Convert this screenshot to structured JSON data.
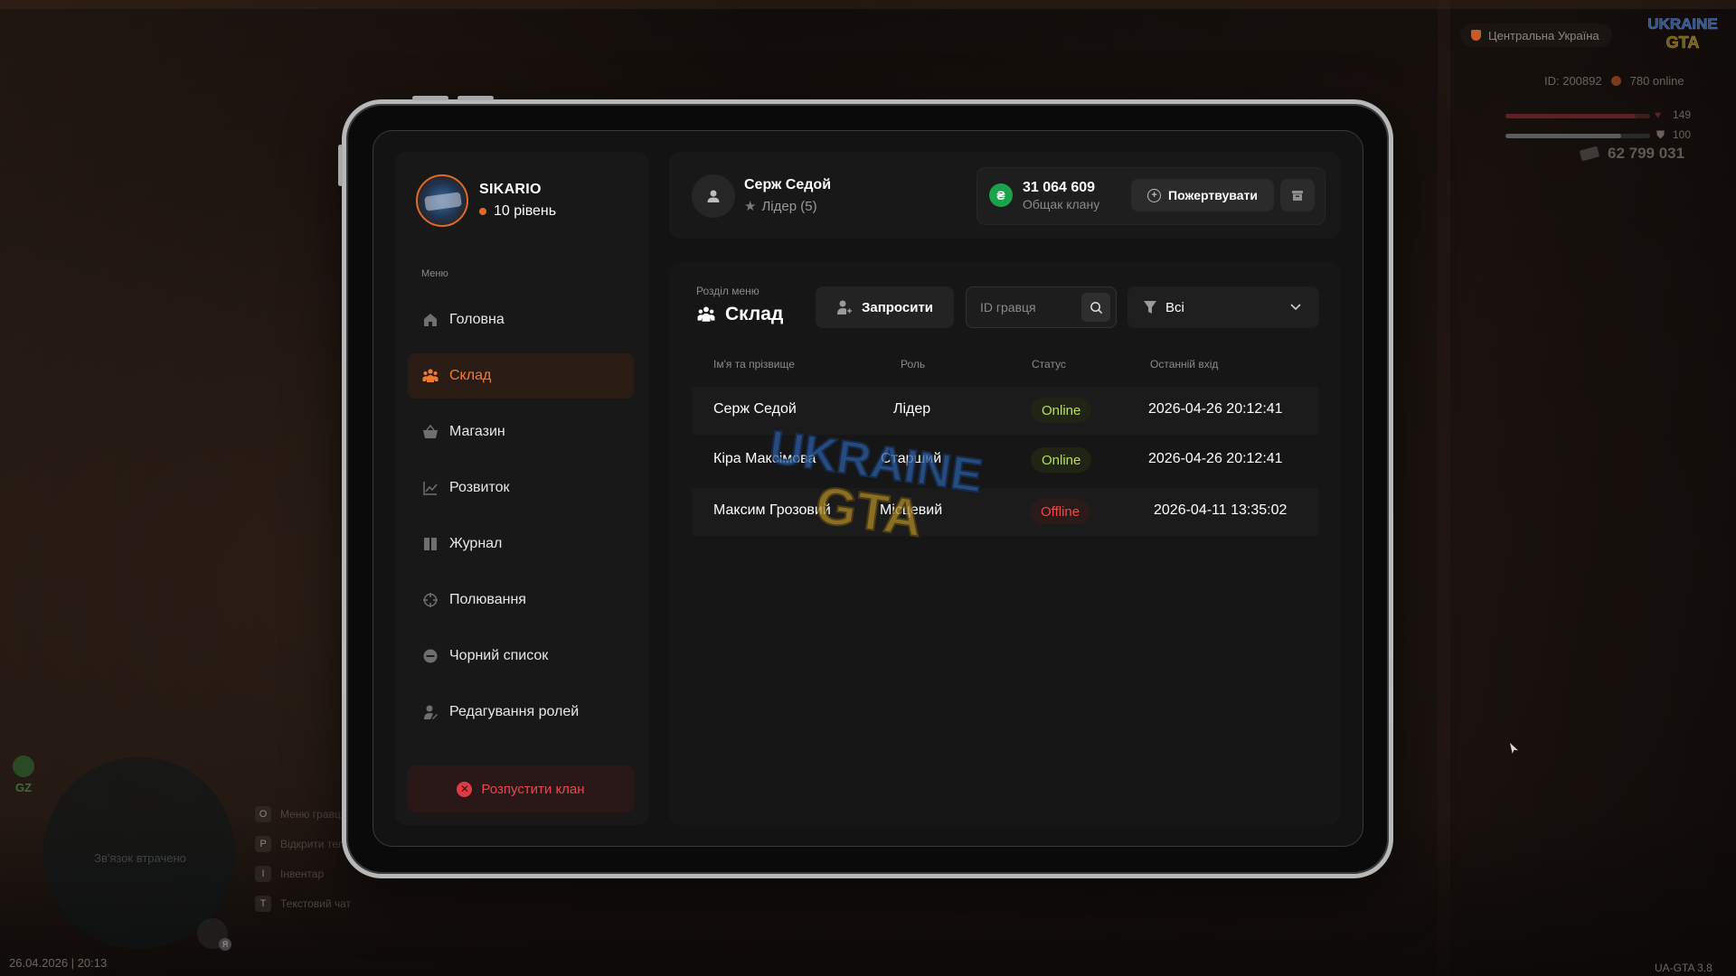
{
  "hud": {
    "region": "Центральна Україна",
    "player_id": "ID: 200892",
    "online": "780 online",
    "health": "149",
    "armor": "100",
    "money": "62 799 031",
    "health_fill": 0.9,
    "armor_fill": 0.8,
    "gz_label": "GZ",
    "connection_lost": "Зв'язок втрачено",
    "hotkeys": [
      {
        "key": "O",
        "label": "Меню гравця"
      },
      {
        "key": "P",
        "label": "Відкрити телефон"
      },
      {
        "key": "I",
        "label": "Інвентар"
      },
      {
        "key": "T",
        "label": "Текстовий чат"
      }
    ],
    "datetime": "26.04.2026 | 20:13",
    "version": "UA-GTA 3.8",
    "mic_badge": "Я"
  },
  "clan": {
    "name": "SIKARIO",
    "level": "10 рівень"
  },
  "menu": {
    "caption": "Меню",
    "items": [
      {
        "label": "Головна",
        "icon": "home-icon"
      },
      {
        "label": "Склад",
        "icon": "members-icon"
      },
      {
        "label": "Магазин",
        "icon": "basket-icon"
      },
      {
        "label": "Розвиток",
        "icon": "chart-icon"
      },
      {
        "label": "Журнал",
        "icon": "book-icon"
      },
      {
        "label": "Полювання",
        "icon": "crosshair-icon"
      },
      {
        "label": "Чорний список",
        "icon": "block-icon"
      },
      {
        "label": "Редагування ролей",
        "icon": "user-edit-icon"
      }
    ],
    "active": "Склад",
    "dissolve_label": "Розпустити клан"
  },
  "user": {
    "name": "Серж Седой",
    "role": "Лідер (5)"
  },
  "bank": {
    "amount": "31 064 609",
    "label": "Общак клану",
    "currency_symbol": "₴",
    "donate_label": "Пожертвувати"
  },
  "section": {
    "caption": "Розділ меню",
    "title": "Склад",
    "invite_label": "Запросити",
    "search_placeholder": "ID гравця",
    "filter_value": "Всі"
  },
  "table": {
    "headers": [
      "Ім'я та прізвище",
      "Роль",
      "Статус",
      "Останній вхід"
    ],
    "rows": [
      {
        "name": "Серж Седой",
        "role": "Лідер",
        "status": "Online",
        "last_login": "2026-04-26 20:12:41"
      },
      {
        "name": "Кіра Максімова",
        "role": "Старший",
        "status": "Online",
        "last_login": "2026-04-26 20:12:41"
      },
      {
        "name": "Максим Грозовий",
        "role": "Місцевий",
        "status": "Offline",
        "last_login": "2026-04-11 13:35:02"
      }
    ]
  },
  "watermark": {
    "line1": "UKRAINE",
    "line2": "GTA"
  },
  "colors": {
    "accent": "#e06a28",
    "online": "#b7e04a",
    "offline": "#ef4a4a",
    "danger": "#e23a44",
    "bank_green": "#1aa34a"
  }
}
